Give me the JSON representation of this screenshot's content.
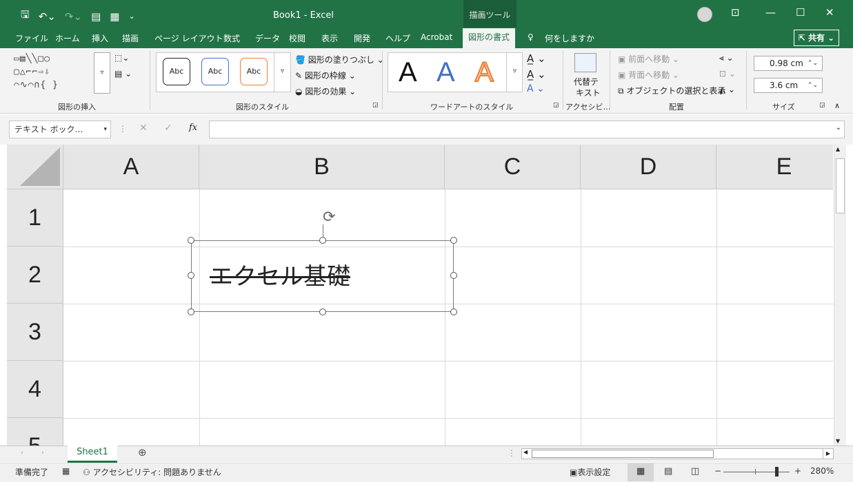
{
  "titlebar": {
    "title": "Book1  -  Excel",
    "context_tab": "描画ツール"
  },
  "tabs": [
    "ファイル",
    "ホーム",
    "挿入",
    "描画",
    "ページ レイアウト",
    "数式",
    "データ",
    "校閲",
    "表示",
    "開発",
    "ヘルプ",
    "Acrobat"
  ],
  "active_tab": "図形の書式",
  "tell_me": "何をしますか",
  "share": "共有",
  "ribbon": {
    "groups": [
      "図形の挿入",
      "図形のスタイル",
      "ワードアートのスタイル",
      "アクセシビ…",
      "配置",
      "サイズ"
    ],
    "style_sample": "Abc",
    "shape_fill": "図形の塗りつぶし",
    "shape_outline": "図形の枠線",
    "shape_effects": "図形の効果",
    "wordart_letter": "A",
    "alt_text_line1": "代替テ",
    "alt_text_line2": "キスト",
    "bring_forward": "前面へ移動",
    "send_backward": "背面へ移動",
    "selection_pane": "オブジェクトの選択と表示",
    "height_value": "0.98 cm",
    "width_value": "3.6 cm"
  },
  "formula_bar": {
    "name_box": "テキスト ボック…",
    "fx": "fx",
    "content": ""
  },
  "grid": {
    "columns": [
      "A",
      "B",
      "C",
      "D",
      "E"
    ],
    "rows": [
      "1",
      "2",
      "3",
      "4",
      "5"
    ]
  },
  "textbox": {
    "text": "エクセル基礎"
  },
  "sheet": {
    "tab": "Sheet1"
  },
  "status": {
    "ready": "準備完了",
    "accessibility": "アクセシビリティ: 問題ありません",
    "display_settings": "表示設定",
    "zoom": "280%"
  },
  "colors": {
    "excel_green": "#217346"
  }
}
